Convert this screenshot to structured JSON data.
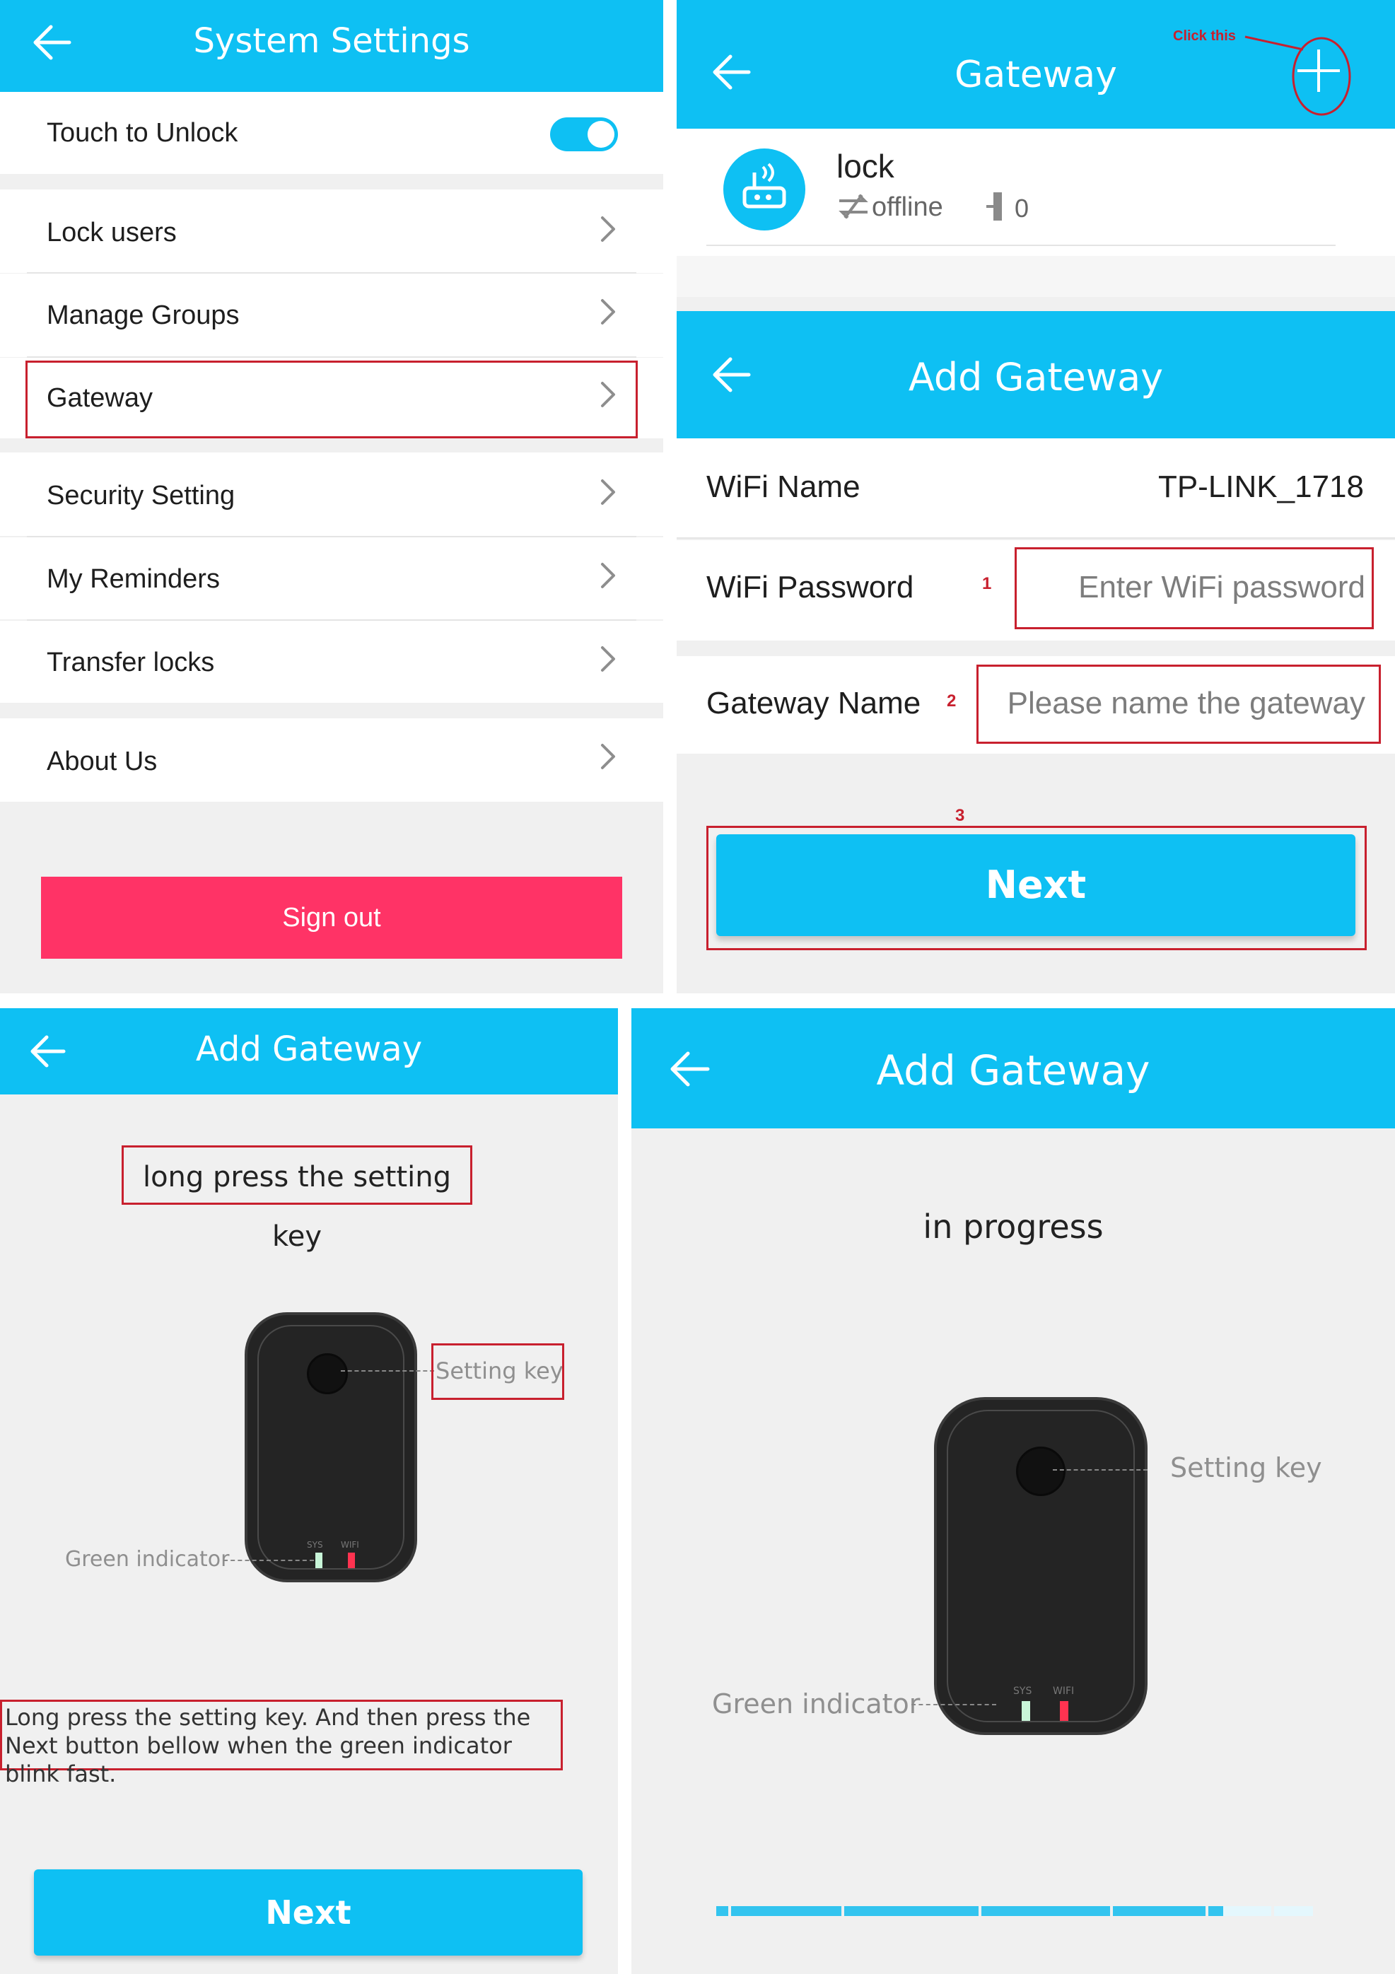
{
  "colors": {
    "accent": "#0ec0f3",
    "danger": "#ff3366",
    "annotation": "#c8202e"
  },
  "settings": {
    "title": "System Settings",
    "touch_unlock_label": "Touch to Unlock",
    "touch_unlock_on": true,
    "items": [
      "Lock users",
      "Manage Groups",
      "Gateway",
      "Security Setting",
      "My Reminders",
      "Transfer locks",
      "About Us"
    ],
    "sign_out": "Sign out"
  },
  "gateway_list": {
    "title": "Gateway",
    "annotation": "Click this",
    "item_name": "lock",
    "status": "offline",
    "count": "0"
  },
  "add_gateway_form": {
    "title": "Add Gateway",
    "wifi_name_label": "WiFi Name",
    "wifi_name_value": "TP-LINK_1718",
    "wifi_password_label": "WiFi Password",
    "wifi_password_placeholder": "Enter WiFi password",
    "gateway_name_label": "Gateway Name",
    "gateway_name_placeholder": "Please name the gateway",
    "step1": "1",
    "step2": "2",
    "step3": "3",
    "next": "Next"
  },
  "add_gateway_instructions": {
    "title": "Add Gateway",
    "heading": "long press the setting key",
    "setting_key": "Setting key",
    "green_indicator": "Green indicator",
    "sys": "SYS",
    "wifi": "WIFI",
    "instruction": "Long press the setting key. And then press the Next button bellow when the green indicator blink fast.",
    "next": "Next"
  },
  "add_gateway_progress": {
    "title": "Add Gateway",
    "status": "in progress",
    "setting_key": "Setting key",
    "green_indicator": "Green indicator",
    "sys": "SYS",
    "wifi": "WIFI",
    "progress": 0.85
  }
}
